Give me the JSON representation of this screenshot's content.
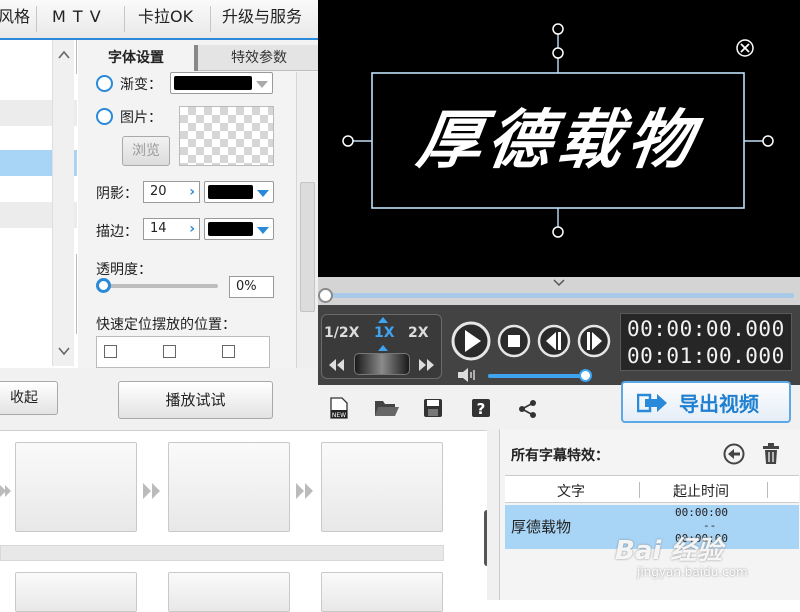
{
  "nav": {
    "items": [
      "风格",
      "M T V",
      "卡拉OK",
      "升级与服务"
    ]
  },
  "tabs": {
    "font_settings": "字体设置",
    "effect_params": "特效参数"
  },
  "font_panel": {
    "gradient_label": "渐变：",
    "image_label": "图片：",
    "browse_label": "浏览",
    "shadow_label": "阴影：",
    "shadow_value": "20",
    "stroke_label": "描边：",
    "stroke_value": "14",
    "opacity_label": "透明度：",
    "opacity_value": "0%",
    "opacity_level": 0,
    "position_label": "快速定位摆放的位置："
  },
  "buttons": {
    "collapse": "收起",
    "preview_play": "播放试试",
    "export": "导出视频"
  },
  "video": {
    "caption_text": "厚德载物"
  },
  "playback": {
    "speeds": [
      "1/2X",
      "1X",
      "2X"
    ],
    "selected_speed": "1X",
    "current_time": "00:00:00.000",
    "total_time": "00:01:00.000",
    "volume_level": 0.92
  },
  "subtitle_panel": {
    "title": "所有字幕特效：",
    "col_text": "文字",
    "col_time": "起止时间",
    "rows": [
      {
        "text": "厚德载物",
        "start": "00:00:00",
        "dash": "--",
        "end": "00:00:00"
      }
    ]
  },
  "watermark": {
    "brand": "Bai 经验",
    "url": "jingyan.baidu.com"
  },
  "colors": {
    "accent": "#2a8ad9",
    "selection": "#a8d4f5",
    "panel_dark": "#434343"
  }
}
